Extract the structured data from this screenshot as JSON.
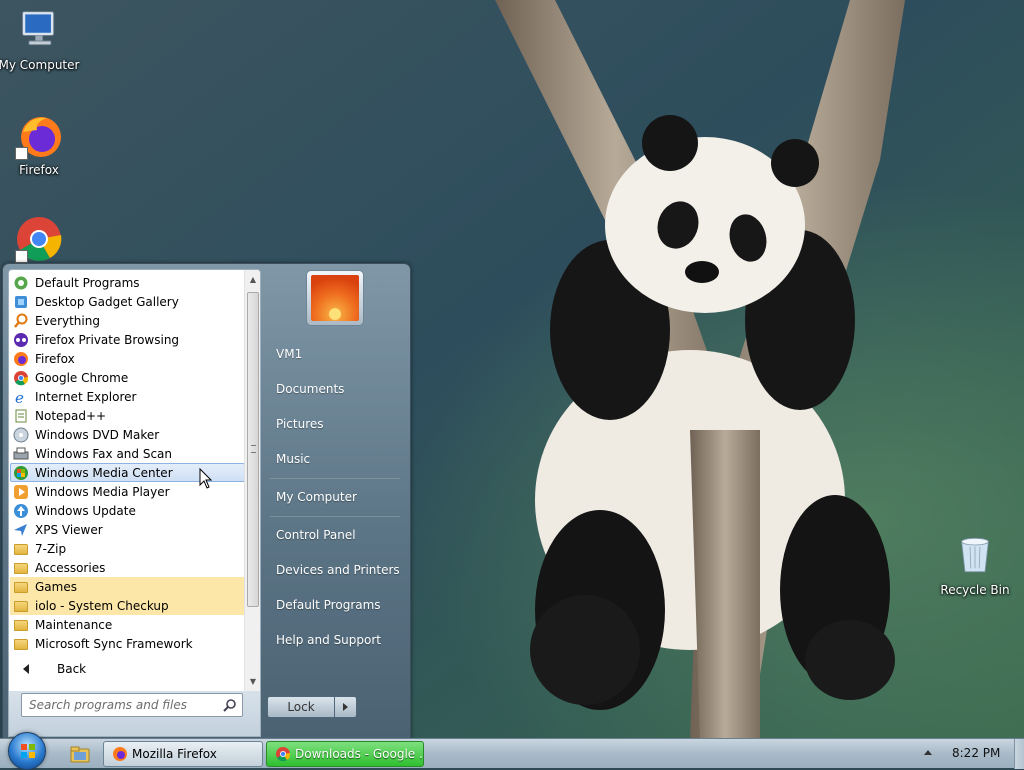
{
  "desktop": {
    "icons": [
      {
        "name": "my-computer",
        "label": "My Computer"
      },
      {
        "name": "firefox",
        "label": "Firefox"
      },
      {
        "name": "google-chrome",
        "label": ""
      },
      {
        "name": "recycle-bin",
        "label": "Recycle Bin"
      }
    ]
  },
  "start_menu": {
    "programs": [
      {
        "label": "Default Programs",
        "icon": "default-programs-icon"
      },
      {
        "label": "Desktop Gadget Gallery",
        "icon": "gadget-gallery-icon"
      },
      {
        "label": "Everything",
        "icon": "everything-search-icon"
      },
      {
        "label": "Firefox Private Browsing",
        "icon": "firefox-private-icon"
      },
      {
        "label": "Firefox",
        "icon": "firefox-icon"
      },
      {
        "label": "Google Chrome",
        "icon": "chrome-icon"
      },
      {
        "label": "Internet Explorer",
        "icon": "internet-explorer-icon"
      },
      {
        "label": "Notepad++",
        "icon": "notepad-plus-plus-icon"
      },
      {
        "label": "Windows DVD Maker",
        "icon": "dvd-maker-icon"
      },
      {
        "label": "Windows Fax and Scan",
        "icon": "fax-scan-icon"
      },
      {
        "label": "Windows Media Center",
        "icon": "media-center-icon"
      },
      {
        "label": "Windows Media Player",
        "icon": "media-player-icon"
      },
      {
        "label": "Windows Update",
        "icon": "windows-update-icon"
      },
      {
        "label": "XPS Viewer",
        "icon": "xps-viewer-icon"
      },
      {
        "label": "7-Zip",
        "icon": "folder-icon"
      },
      {
        "label": "Accessories",
        "icon": "folder-icon"
      },
      {
        "label": "Games",
        "icon": "folder-icon"
      },
      {
        "label": "iolo - System Checkup",
        "icon": "folder-icon"
      },
      {
        "label": "Maintenance",
        "icon": "folder-icon"
      },
      {
        "label": "Microsoft Sync Framework",
        "icon": "folder-icon"
      }
    ],
    "hovered_program": "Windows Media Center",
    "highlighted_folders": [
      "Games",
      "iolo - System Checkup"
    ],
    "back_label": "Back",
    "search_placeholder": "Search programs and files",
    "right_items": {
      "user": "VM1",
      "documents": "Documents",
      "pictures": "Pictures",
      "music": "Music",
      "my_computer": "My Computer",
      "control_panel": "Control Panel",
      "devices_printers": "Devices and Printers",
      "default_programs": "Default Programs",
      "help_support": "Help and Support"
    },
    "lock_label": "Lock"
  },
  "taskbar": {
    "buttons": [
      {
        "label": "Mozilla Firefox",
        "active": false
      },
      {
        "label": "Downloads - Google ...",
        "active": true
      }
    ],
    "clock": "8:22 PM"
  },
  "colors": {
    "hover_bg": "#cfe0f5",
    "folder_highlight": "#fce7a9",
    "active_taskbar": "#2fbf2f"
  }
}
